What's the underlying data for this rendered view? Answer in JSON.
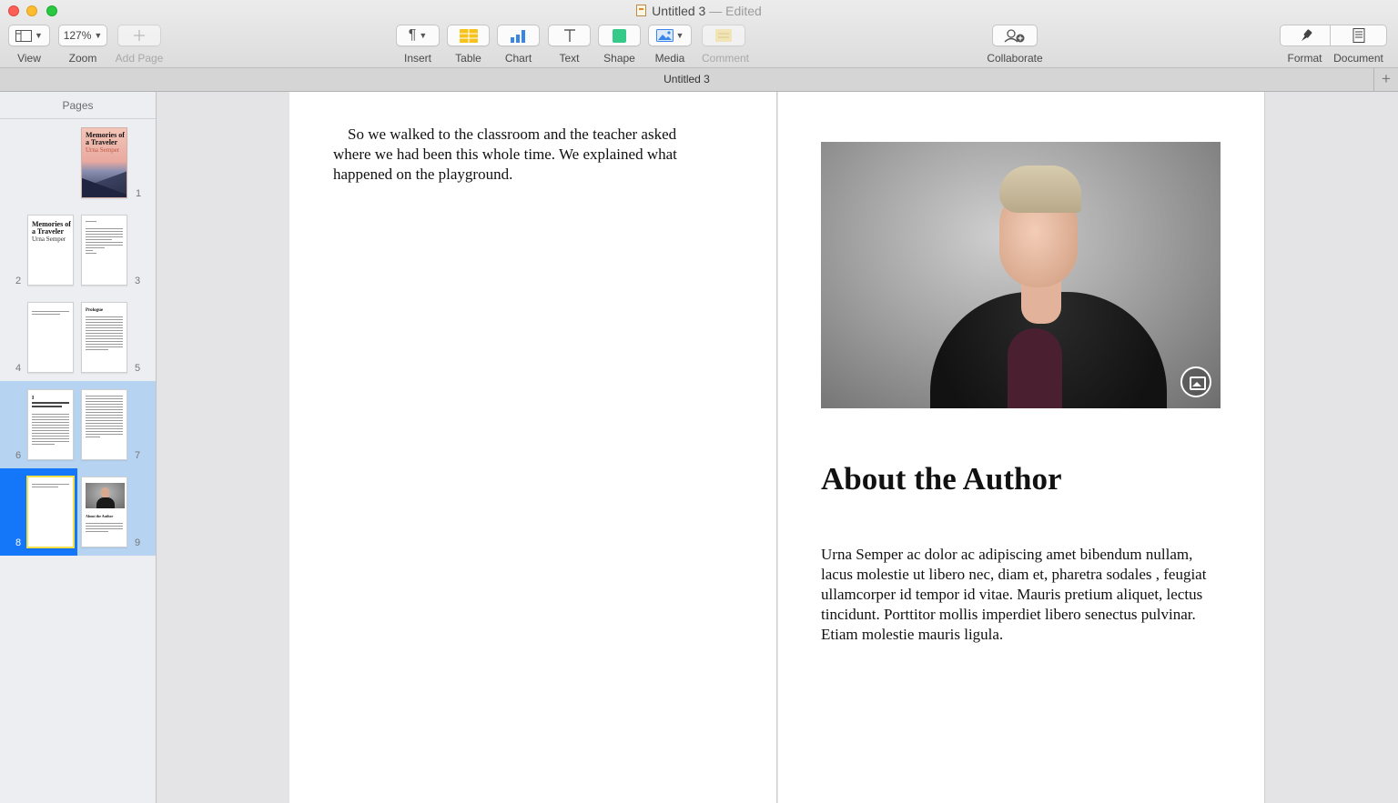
{
  "window": {
    "title": "Untitled 3",
    "edited": " — Edited"
  },
  "toolbar": {
    "view_label": "View",
    "zoom_value": "127%",
    "zoom_label": "Zoom",
    "add_page_label": "Add Page",
    "insert_label": "Insert",
    "table_label": "Table",
    "chart_label": "Chart",
    "text_label": "Text",
    "shape_label": "Shape",
    "media_label": "Media",
    "comment_label": "Comment",
    "collaborate_label": "Collaborate",
    "format_label": "Format",
    "document_label": "Document"
  },
  "tabbar": {
    "title": "Untitled 3"
  },
  "sidebar": {
    "title": "Pages",
    "pages": [
      {
        "number": "1",
        "title": "Memories of a Traveler",
        "subtitle": "Urna Semper"
      },
      {
        "number": "2",
        "title": "Memories of a Traveler",
        "subtitle": "Urna Semper"
      },
      {
        "number": "3"
      },
      {
        "number": "4"
      },
      {
        "number": "5",
        "title": "Prologue"
      },
      {
        "number": "6",
        "title": "I"
      },
      {
        "number": "7"
      },
      {
        "number": "8"
      },
      {
        "number": "9",
        "title": "About the Author"
      }
    ]
  },
  "document": {
    "left_page_text": "So we walked to the classroom and the teacher asked where we had been this whole time. We explained what happened on the playground.",
    "heading": "About the Author",
    "bio": "Urna Semper ac dolor ac adipiscing amet bibendum nullam, lacus molestie ut libero nec, diam et, pharetra sodales , feugiat ullamcorper id tempor id vitae. Mauris pretium aliquet, lectus tincidunt. Porttitor mollis imperdiet libero senectus pulvinar. Etiam molestie mauris ligula."
  },
  "colors": {
    "selection": "#1476f8",
    "row_highlight": "#b6d3f2",
    "current_page_border": "#f3e04a"
  }
}
